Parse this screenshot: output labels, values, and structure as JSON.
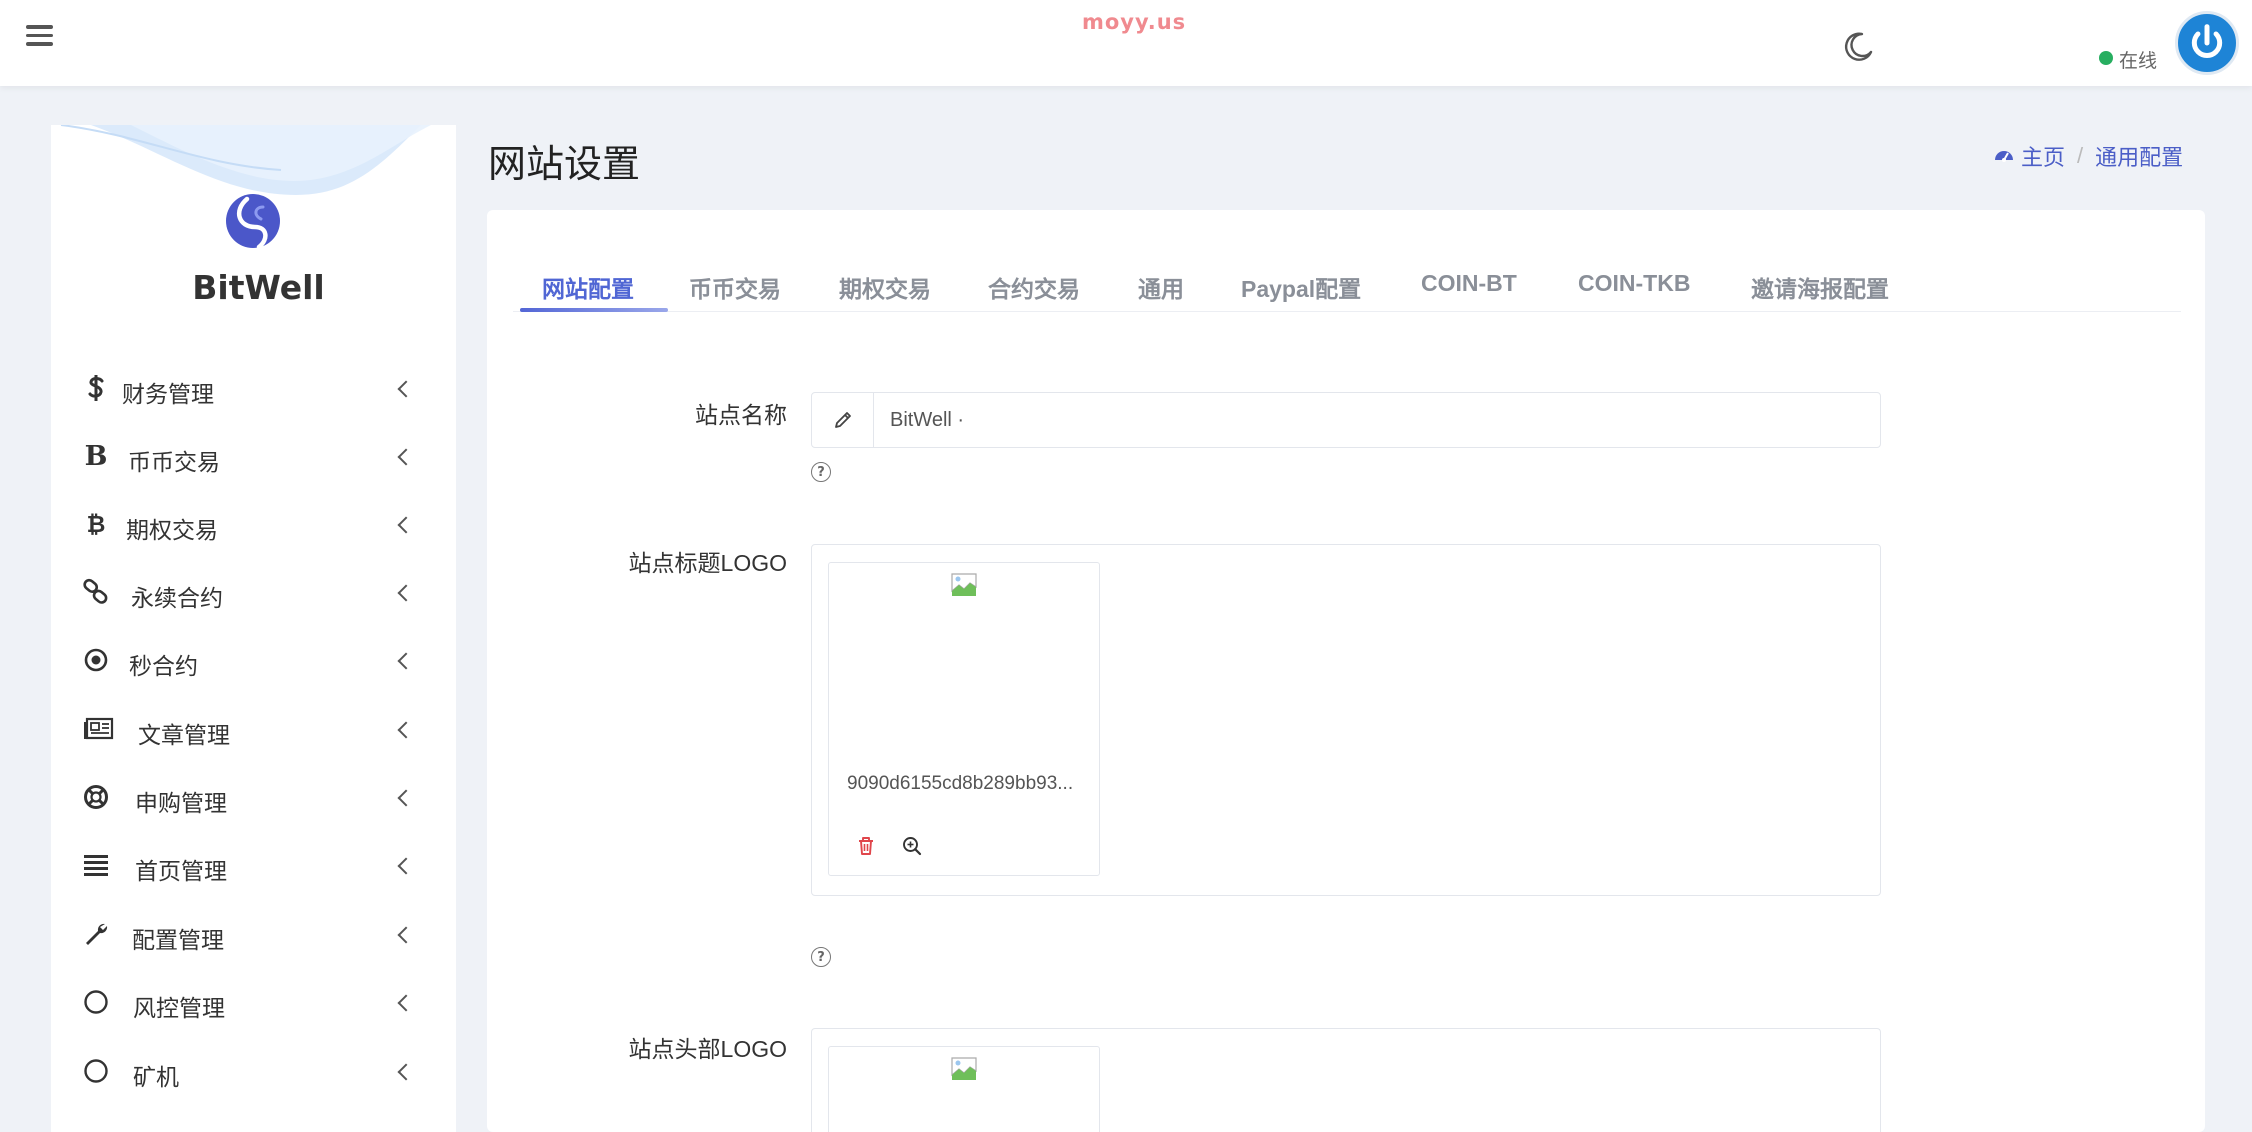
{
  "header": {
    "watermark": "moyy.us",
    "status_text": "在线",
    "status_color": "#27ae60",
    "icons": [
      "menu-icon",
      "moon-icon",
      "power-icon"
    ]
  },
  "sidebar": {
    "brand": "BitWell",
    "items": [
      {
        "label": "财务管理",
        "icon": "dollar-icon"
      },
      {
        "label": "币币交易",
        "icon": "bold-b-icon"
      },
      {
        "label": "期权交易",
        "icon": "bitcoin-icon"
      },
      {
        "label": "永续合约",
        "icon": "link-icon"
      },
      {
        "label": "秒合约",
        "icon": "dot-circle-icon"
      },
      {
        "label": "文章管理",
        "icon": "newspaper-icon"
      },
      {
        "label": "申购管理",
        "icon": "life-ring-icon"
      },
      {
        "label": "首页管理",
        "icon": "list-icon"
      },
      {
        "label": "配置管理",
        "icon": "wrench-icon"
      },
      {
        "label": "风控管理",
        "icon": "circle-icon"
      },
      {
        "label": "矿机",
        "icon": "circle-icon"
      }
    ]
  },
  "page": {
    "title": "网站设置",
    "breadcrumb": {
      "home": "主页",
      "current": "通用配置"
    }
  },
  "tabs": [
    {
      "label": "网站配置",
      "active": true
    },
    {
      "label": "币币交易",
      "active": false
    },
    {
      "label": "期权交易",
      "active": false
    },
    {
      "label": "合约交易",
      "active": false
    },
    {
      "label": "通用",
      "active": false
    },
    {
      "label": "Paypal配置",
      "active": false
    },
    {
      "label": "COIN-BT",
      "active": false
    },
    {
      "label": "COIN-TKB",
      "active": false
    },
    {
      "label": "邀请海报配置",
      "active": false
    }
  ],
  "form": {
    "site_name": {
      "label": "站点名称",
      "value": "BitWell ·"
    },
    "title_logo": {
      "label": "站点标题LOGO",
      "file_name": "9090d6155cd8b289bb93..."
    },
    "header_logo": {
      "label": "站点头部LOGO"
    }
  },
  "colors": {
    "accent": "#5066d4",
    "page_bg": "#eff2f7",
    "power_button": "#1e84d6",
    "delete": "#e0464b"
  }
}
